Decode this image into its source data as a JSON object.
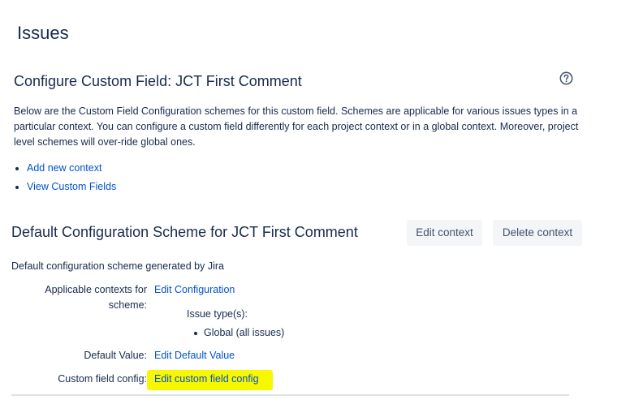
{
  "page": {
    "title": "Issues"
  },
  "configure": {
    "title": "Configure Custom Field: JCT First Comment",
    "help_icon": "question-circle-icon",
    "description": "Below are the Custom Field Configuration schemes for this custom field. Schemes are applicable for various issues types in a particular context. You can configure a custom field differently for each project context or in a global context. Moreover, project level schemes will over-ride global ones.",
    "links": [
      {
        "label": "Add new context"
      },
      {
        "label": "View Custom Fields"
      }
    ]
  },
  "scheme": {
    "title": "Default Configuration Scheme for JCT First Comment",
    "edit_context_label": "Edit context",
    "delete_context_label": "Delete context",
    "description": "Default configuration scheme generated by Jira",
    "applicable_contexts_label": "Applicable contexts for scheme:",
    "edit_configuration_link": "Edit Configuration",
    "issue_types_heading": "Issue type(s):",
    "issue_types": [
      "Global (all issues)"
    ],
    "default_value_label": "Default Value:",
    "edit_default_value_link": "Edit Default Value",
    "custom_field_config_label": "Custom field config:",
    "edit_custom_field_config_link": "Edit custom field config"
  },
  "colors": {
    "link": "#0052cc",
    "text": "#172b4d",
    "button_bg": "#f4f5f7",
    "highlight": "#f7f700"
  }
}
